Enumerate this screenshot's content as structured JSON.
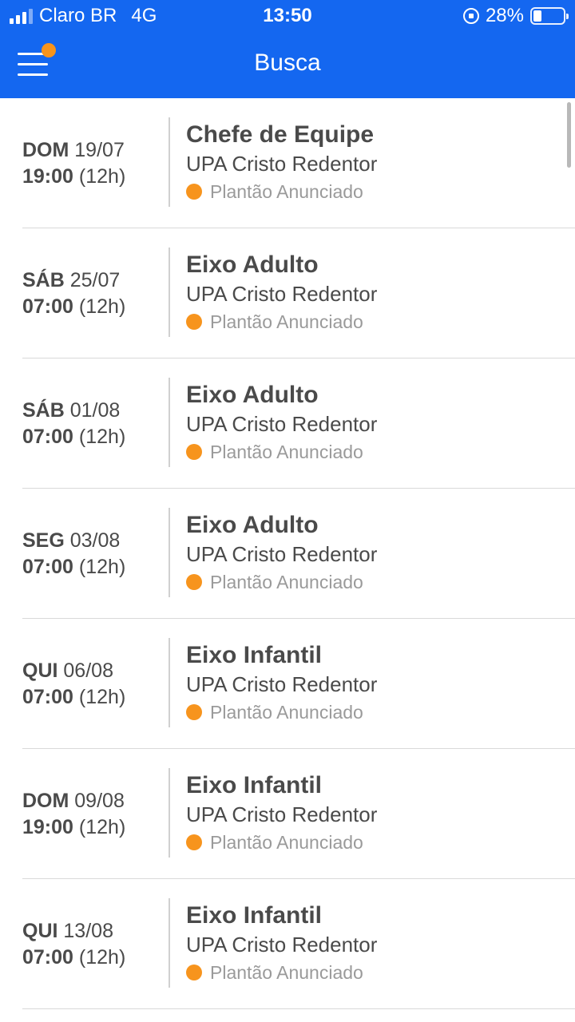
{
  "status_bar": {
    "carrier": "Claro BR",
    "network": "4G",
    "time": "13:50",
    "battery": "28%",
    "battery_level": 0.28
  },
  "header": {
    "title": "Busca",
    "background_color": "#1467f0",
    "menu_icon": "hamburger-menu-icon",
    "badge_color": "#f7941d"
  },
  "shifts": [
    {
      "day": "DOM",
      "date": "19/07",
      "time": "19:00",
      "duration": "(12h)",
      "role": "Chefe de Equipe",
      "place": "UPA Cristo Redentor",
      "status": "Plantão Anunciado"
    },
    {
      "day": "SÁB",
      "date": "25/07",
      "time": "07:00",
      "duration": "(12h)",
      "role": "Eixo Adulto",
      "place": "UPA Cristo Redentor",
      "status": "Plantão Anunciado"
    },
    {
      "day": "SÁB",
      "date": "01/08",
      "time": "07:00",
      "duration": "(12h)",
      "role": "Eixo Adulto",
      "place": "UPA Cristo Redentor",
      "status": "Plantão Anunciado"
    },
    {
      "day": "SEG",
      "date": "03/08",
      "time": "07:00",
      "duration": "(12h)",
      "role": "Eixo Adulto",
      "place": "UPA Cristo Redentor",
      "status": "Plantão Anunciado"
    },
    {
      "day": "QUI",
      "date": "06/08",
      "time": "07:00",
      "duration": "(12h)",
      "role": "Eixo Infantil",
      "place": "UPA Cristo Redentor",
      "status": "Plantão Anunciado"
    },
    {
      "day": "DOM",
      "date": "09/08",
      "time": "19:00",
      "duration": "(12h)",
      "role": "Eixo Infantil",
      "place": "UPA Cristo Redentor",
      "status": "Plantão Anunciado"
    },
    {
      "day": "QUI",
      "date": "13/08",
      "time": "07:00",
      "duration": "(12h)",
      "role": "Eixo Infantil",
      "place": "UPA Cristo Redentor",
      "status": "Plantão Anunciado"
    }
  ],
  "status_color": "#f7941d"
}
